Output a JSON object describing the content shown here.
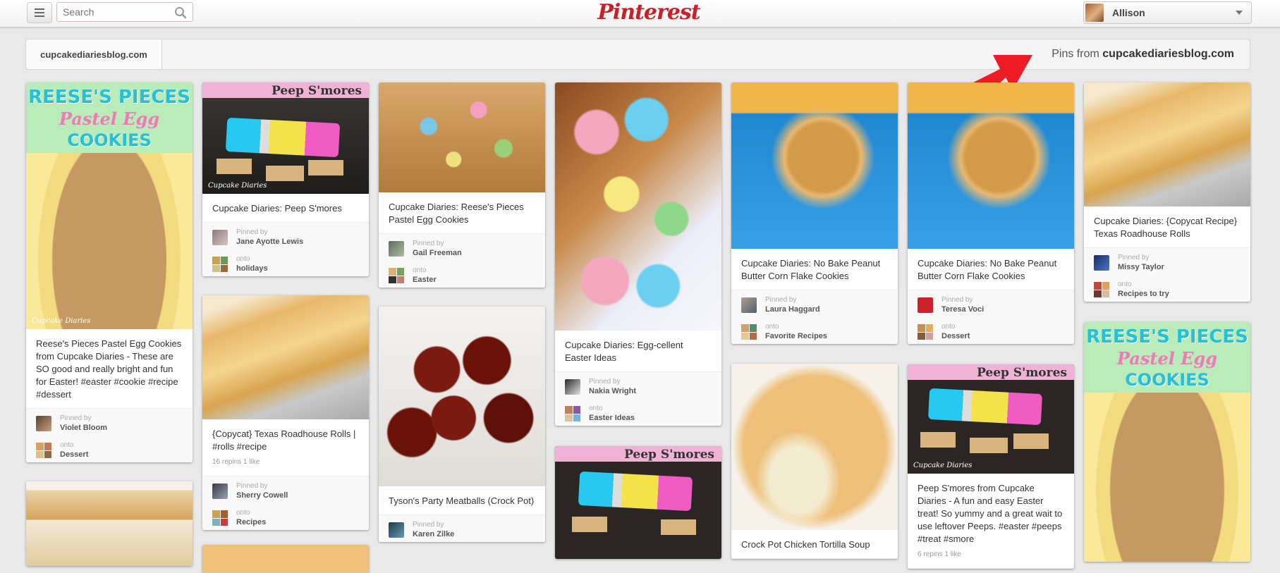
{
  "header": {
    "search_placeholder": "Search",
    "logo": "Pinterest",
    "user_name": "Allison"
  },
  "source": {
    "domain": "cupcakediariesblog.com",
    "pins_from_prefix": "Pins from",
    "pins_from_domain": "cupcakediariesblog.com"
  },
  "labels": {
    "pinned_by": "Pinned by",
    "onto": "onto"
  },
  "pins": [
    {
      "overlay": [
        "REESE'S PIECES",
        "Pastel Egg",
        "COOKIES"
      ],
      "watermark": "Cupcake Diaries",
      "description": "Reese's Pieces Pastel Egg Cookies from Cupcake Diaries - These are SO good and really bright and fun for Easter! #easter #cookie #recipe #dessert",
      "pinner": "Violet Bloom",
      "board": "Dessert"
    },
    {
      "strip": "Peep S'mores",
      "watermark": "Cupcake Diaries",
      "description": "Cupcake Diaries: Peep S'mores",
      "pinner": "Jane Ayotte Lewis",
      "board": "holidays"
    },
    {
      "description": "Cupcake Diaries: Reese's Pieces Pastel Egg Cookies",
      "pinner": "Gail Freeman",
      "board": "Easter"
    },
    {
      "description": "Cupcake Diaries: Egg-cellent Easter Ideas",
      "pinner": "Nakia Wright",
      "board": "Easter Ideas"
    },
    {
      "description": "Cupcake Diaries: No Bake Peanut Butter Corn Flake Cookies",
      "pinner": "Laura Haggard",
      "board": "Favorite Recipes"
    },
    {
      "description": "Cupcake Diaries: No Bake Peanut Butter Corn Flake Cookies",
      "pinner": "Teresa Voci",
      "board": "Dessert"
    },
    {
      "description": "Cupcake Diaries: {Copycat Recipe} Texas Roadhouse Rolls",
      "pinner": "Missy Taylor",
      "board": "Recipes to try"
    },
    {
      "description": "{Copycat} Texas Roadhouse Rolls | #rolls #recipe",
      "stats": "16 repins  1 like",
      "pinner": "Sherry Cowell",
      "board": "Recipes"
    },
    {
      "description": "Tyson's Party Meatballs (Crock Pot)",
      "pinner": "Karen Zilke"
    },
    {
      "strip": "Peep S'mores"
    },
    {
      "description": "Crock Pot Chicken Tortilla Soup"
    },
    {
      "strip": "Peep S'mores",
      "watermark": "Cupcake Diaries",
      "description": "Peep S'mores from Cupcake Diaries - A fun and easy Easter treat! So yummy and a great wait to use leftover Peeps. #easter #peeps #treat #smore",
      "stats": "6 repins  1 like"
    },
    {
      "overlay": [
        "REESE'S PIECES",
        "Pastel Egg",
        "COOKIES"
      ]
    },
    {}
  ]
}
